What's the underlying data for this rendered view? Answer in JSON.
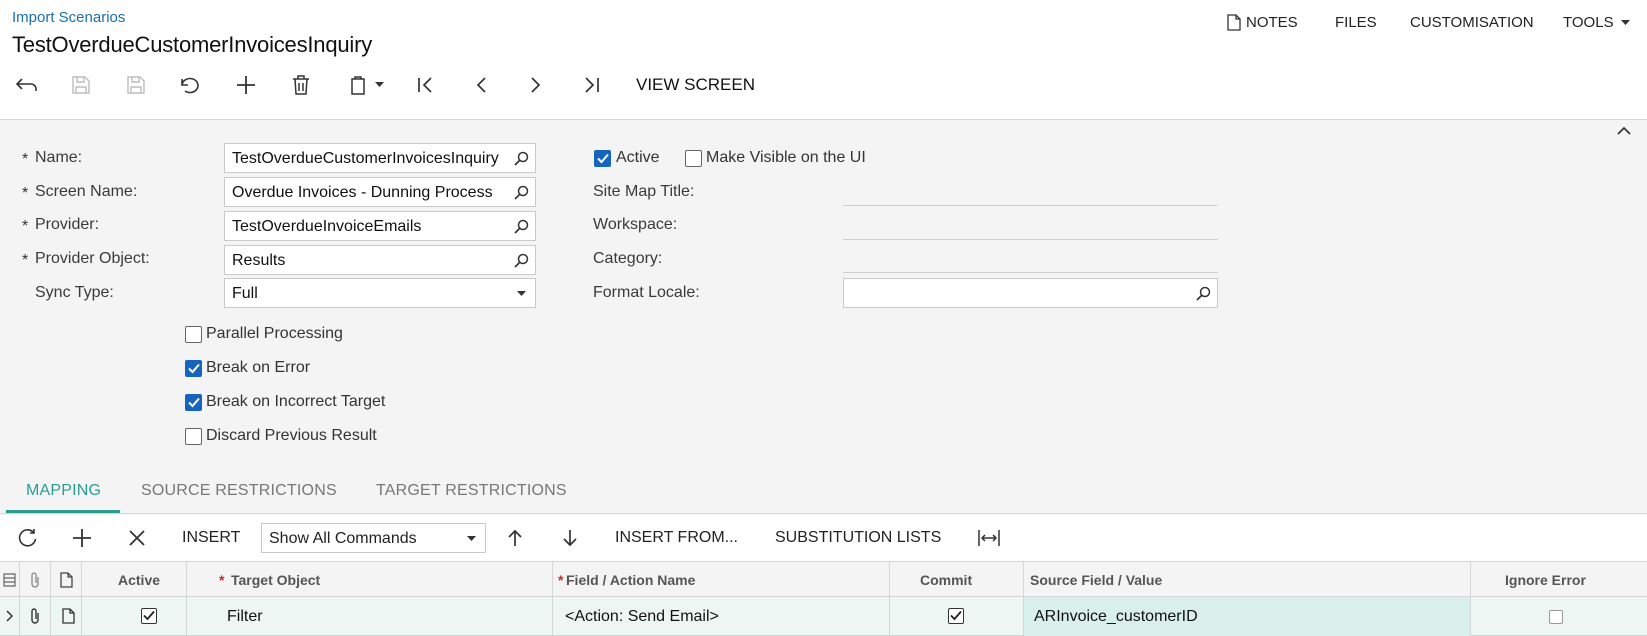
{
  "header": {
    "breadcrumb": "Import Scenarios",
    "title": "TestOverdueCustomerInvoicesInquiry",
    "menu": {
      "notes": "NOTES",
      "files": "FILES",
      "customisation": "CUSTOMISATION",
      "tools": "TOOLS"
    }
  },
  "toolbar": {
    "view_screen": "VIEW SCREEN",
    "icons": [
      "undo-back-icon",
      "save-close-icon",
      "save-icon",
      "cancel-icon",
      "add-icon",
      "delete-icon",
      "clipboard-icon",
      "first-icon",
      "previous-icon",
      "next-icon",
      "last-icon"
    ]
  },
  "form": {
    "name_label": "Name:",
    "name_value": "TestOverdueCustomerInvoicesInquiry",
    "screen_name_label": "Screen Name:",
    "screen_name_value": "Overdue Invoices - Dunning Process",
    "provider_label": "Provider:",
    "provider_value": "TestOverdueInvoiceEmails",
    "provider_object_label": "Provider Object:",
    "provider_object_value": "Results",
    "sync_type_label": "Sync Type:",
    "sync_type_value": "Full",
    "required_mark": "*",
    "active_label": "Active",
    "active_checked": true,
    "make_visible_label": "Make Visible on the UI",
    "make_visible_checked": false,
    "site_map_title_label": "Site Map Title:",
    "workspace_label": "Workspace:",
    "category_label": "Category:",
    "format_locale_label": "Format Locale:",
    "parallel_processing_label": "Parallel Processing",
    "parallel_processing_checked": false,
    "break_on_error_label": "Break on Error",
    "break_on_error_checked": true,
    "break_on_incorrect_target_label": "Break on Incorrect Target",
    "break_on_incorrect_target_checked": true,
    "discard_previous_result_label": "Discard Previous Result",
    "discard_previous_result_checked": false
  },
  "tabs": [
    {
      "label": "MAPPING",
      "active": true
    },
    {
      "label": "SOURCE RESTRICTIONS",
      "active": false
    },
    {
      "label": "TARGET RESTRICTIONS",
      "active": false
    }
  ],
  "grid_toolbar": {
    "insert": "INSERT",
    "commands_select": "Show All Commands",
    "insert_from": "INSERT FROM...",
    "substitution_lists": "SUBSTITUTION LISTS"
  },
  "grid": {
    "columns": {
      "active": "Active",
      "target_object": "Target Object",
      "field_action": "Field / Action Name",
      "commit": "Commit",
      "source_field": "Source Field / Value",
      "ignore_error": "Ignore Error"
    },
    "rows": [
      {
        "active": true,
        "target_object": "Filter",
        "field_action": "<Action: Send Email>",
        "commit": true,
        "source_field": "ARInvoice_customerID",
        "ignore_error": false
      }
    ]
  },
  "colors": {
    "accent_teal": "#2a9d8f",
    "link_blue": "#1a6fb0",
    "checkbox_blue": "#1565c0",
    "row_highlight": "#eef6f4"
  }
}
